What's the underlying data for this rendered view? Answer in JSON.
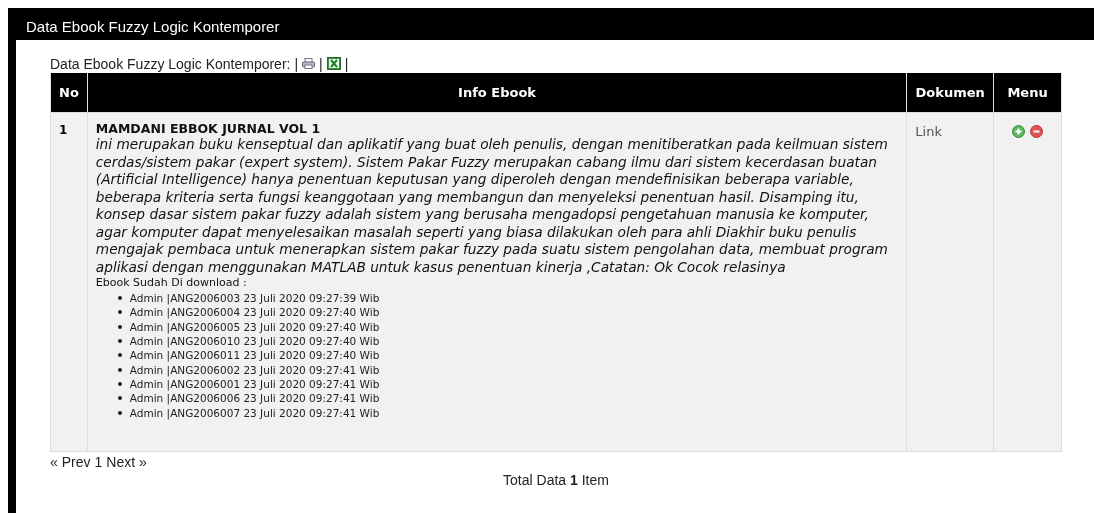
{
  "panel": {
    "title": "Data Ebook Fuzzy Logic Kontemporer"
  },
  "toolbar": {
    "caption": "Data Ebook Fuzzy Logic Kontemporer:",
    "separators": [
      "|",
      "|",
      "|"
    ]
  },
  "table": {
    "columns": [
      "No",
      "Info Ebook",
      "Dokumen",
      "Menu"
    ],
    "rows": [
      {
        "no": "1",
        "title": "MAMDANI EBBOK JURNAL VOL 1",
        "description": "ini merupakan buku kenseptual dan aplikatif yang buat oleh penulis, dengan menitiberatkan pada keilmuan sistem cerdas/sistem pakar (expert system). Sistem Pakar Fuzzy merupakan cabang ilmu dari sistem kecerdasan buatan (Artificial Intelligence) hanya penentuan keputusan yang diperoleh dengan mendefinisikan beberapa variable, beberapa kriteria serta fungsi keanggotaan yang membangun dan menyeleksi penentuan hasil. Disamping itu, konsep dasar sistem pakar fuzzy adalah sistem yang berusaha mengadopsi pengetahuan manusia ke komputer, agar komputer dapat menyelesaikan masalah seperti yang biasa dilakukan oleh para ahli Diakhir buku penulis mengajak pembaca untuk menerapkan sistem pakar fuzzy pada suatu sistem pengolahan data, membuat program aplikasi dengan menggunakan MATLAB untuk kasus penentuan kinerja ,Catatan: Ok Cocok relasinya",
        "download_label": "Ebook Sudah Di download :",
        "downloads": [
          "Admin |ANG2006003 23 Juli 2020 09:27:39 Wib",
          "Admin |ANG2006004 23 Juli 2020 09:27:40 Wib",
          "Admin |ANG2006005 23 Juli 2020 09:27:40 Wib",
          "Admin |ANG2006010 23 Juli 2020 09:27:40 Wib",
          "Admin |ANG2006011 23 Juli 2020 09:27:40 Wib",
          "Admin |ANG2006002 23 Juli 2020 09:27:41 Wib",
          "Admin |ANG2006001 23 Juli 2020 09:27:41 Wib",
          "Admin |ANG2006006 23 Juli 2020 09:27:41 Wib",
          "Admin |ANG2006007 23 Juli 2020 09:27:41 Wib"
        ],
        "document": "Link"
      }
    ]
  },
  "pagination": {
    "prev": "« Prev",
    "page": "1",
    "next": "Next »"
  },
  "total": "Total Data **1** Item"
}
